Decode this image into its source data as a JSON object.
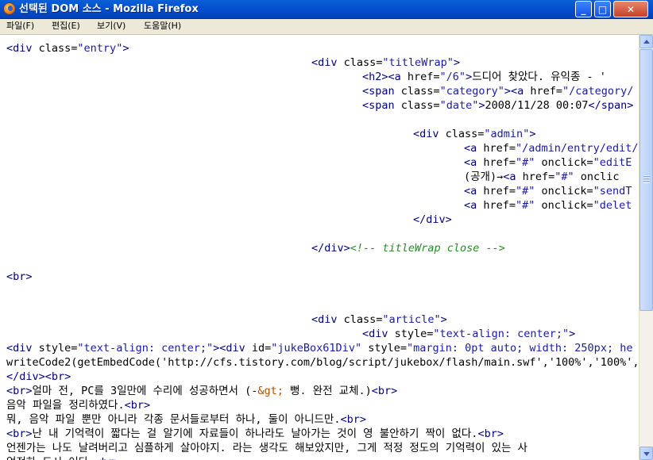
{
  "window": {
    "title": "선택된 DOM 소스 - Mozilla Firefox",
    "minimize_glyph": "_",
    "maximize_glyph": "□",
    "close_glyph": "✕"
  },
  "menu": [
    "파일(F)",
    "편집(E)",
    "보기(V)",
    "도움말(H)"
  ],
  "colors": {
    "tag": "#000080",
    "attribute_value": "#1a1aa6",
    "comment": "#2a8a2a",
    "entity": "#b05000",
    "titlebar": "#0450d0",
    "menubar": "#ece9d8"
  },
  "source_lines": [
    [
      [
        "tag",
        "<div "
      ],
      [
        "attr",
        "class="
      ],
      [
        "val",
        "\"entry\""
      ],
      [
        "tag",
        ">"
      ]
    ],
    [
      [
        "tag",
        "<div "
      ],
      [
        "attr",
        "class="
      ],
      [
        "val",
        "\"titleWrap\""
      ],
      [
        "tag",
        ">"
      ]
    ],
    [
      [
        "tag",
        "<h2"
      ],
      [
        "tag",
        "><a "
      ],
      [
        "attr",
        "href="
      ],
      [
        "val",
        "\"/6\""
      ],
      [
        "tag",
        ">"
      ],
      [
        "txt",
        "드디어 찾았다. 유익종 - '"
      ]
    ],
    [
      [
        "tag",
        "<span "
      ],
      [
        "attr",
        "class="
      ],
      [
        "val",
        "\"category\""
      ],
      [
        "tag",
        "><a "
      ],
      [
        "attr",
        "href="
      ],
      [
        "val",
        "\"/category/"
      ]
    ],
    [
      [
        "tag",
        "<span "
      ],
      [
        "attr",
        "class="
      ],
      [
        "val",
        "\"date\""
      ],
      [
        "tag",
        ">"
      ],
      [
        "txt",
        "2008/11/28 00:07"
      ],
      [
        "tag",
        "</span>"
      ]
    ],
    [
      [
        "tag",
        "<div "
      ],
      [
        "attr",
        "class="
      ],
      [
        "val",
        "\"admin\""
      ],
      [
        "tag",
        ">"
      ]
    ],
    [
      [
        "tag",
        "<a "
      ],
      [
        "attr",
        "href="
      ],
      [
        "val",
        "\"/admin/entry/edit/"
      ]
    ],
    [
      [
        "tag",
        "<a "
      ],
      [
        "attr",
        "href="
      ],
      [
        "val",
        "\"#\""
      ],
      [
        "attr",
        " onclick="
      ],
      [
        "val",
        "\"editE"
      ]
    ],
    [
      [
        "txt",
        "(공개)→"
      ],
      [
        "tag",
        "<a "
      ],
      [
        "attr",
        "href="
      ],
      [
        "val",
        "\"#\""
      ],
      [
        "attr",
        " onclic"
      ]
    ],
    [
      [
        "tag",
        "<a "
      ],
      [
        "attr",
        "href="
      ],
      [
        "val",
        "\"#\""
      ],
      [
        "attr",
        " onclick="
      ],
      [
        "val",
        "\"sendT"
      ]
    ],
    [
      [
        "tag",
        "<a "
      ],
      [
        "attr",
        "href="
      ],
      [
        "val",
        "\"#\""
      ],
      [
        "attr",
        " onclick="
      ],
      [
        "val",
        "\"delet"
      ]
    ],
    [
      [
        "tag",
        "</div>"
      ]
    ],
    [
      [
        "tag",
        "</div>"
      ],
      [
        "cmt",
        "<!-- titleWrap close -->"
      ]
    ],
    [
      [
        "tag",
        "<br>"
      ]
    ],
    [
      [
        "tag",
        "<div "
      ],
      [
        "attr",
        "class="
      ],
      [
        "val",
        "\"article\""
      ],
      [
        "tag",
        ">"
      ]
    ],
    [
      [
        "tag",
        "<div "
      ],
      [
        "attr",
        "style="
      ],
      [
        "val",
        "\"text-align: center;\""
      ],
      [
        "tag",
        ">"
      ]
    ],
    [
      [
        "tag",
        "<div "
      ],
      [
        "attr",
        "style="
      ],
      [
        "val",
        "\"text-align: center;\""
      ],
      [
        "tag",
        "><div "
      ],
      [
        "attr",
        "id="
      ],
      [
        "val",
        "\"jukeBox61Div\""
      ],
      [
        "attr",
        " style="
      ],
      [
        "val",
        "\"margin: 0pt auto; width: 250px; he"
      ]
    ],
    [
      [
        "txt",
        "writeCode2(getEmbedCode('http://cfs.tistory.com/blog/script/jukebox/flash/main.swf','100%','100%','"
      ]
    ],
    [
      [
        "tag",
        "</div><br>"
      ]
    ],
    [
      [
        "tag",
        "<br>"
      ],
      [
        "txt",
        "얼마 전, PC를 3일만에 수리에 성공하면서 (-"
      ],
      [
        "ent",
        "&gt;"
      ],
      [
        "txt",
        " 뻥. 완전 교체.)"
      ],
      [
        "tag",
        "<br>"
      ]
    ],
    [
      [
        "txt",
        "음악 파일을 정리하였다."
      ],
      [
        "tag",
        "<br>"
      ]
    ],
    [
      [
        "txt",
        "뭐, 음악 파일 뿐만 아니라 각종 문서들로부터 하나, 둘이 아니드만."
      ],
      [
        "tag",
        "<br>"
      ]
    ],
    [
      [
        "tag",
        "<br>"
      ],
      [
        "txt",
        "난 내 기억력이 짧다는 걸 알기에 자료들이 하나라도 날아가는 것이 영 불안하기 짝이 없다."
      ],
      [
        "tag",
        "<br>"
      ]
    ],
    [
      [
        "txt",
        "언젠가는 나도 날려버리고 심플하게 살아야지. 라는 생각도 해보았지만, 그게 적정 정도의 기억력이 있는 사"
      ]
    ],
    [
      [
        "txt",
        "얻전하 드시 어다 "
      ],
      [
        "tag",
        "<br>"
      ]
    ]
  ]
}
